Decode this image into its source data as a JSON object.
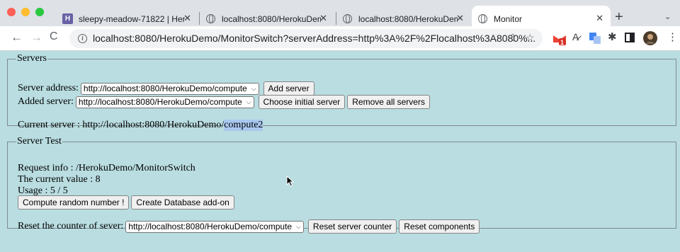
{
  "browser": {
    "tabs": [
      {
        "title": "sleepy-meadow-71822 | Her",
        "active": false,
        "favicon": "heroku-icon"
      },
      {
        "title": "localhost:8080/HerokuDemo",
        "active": false,
        "favicon": "globe-icon"
      },
      {
        "title": "localhost:8080/HerokuDemo",
        "active": false,
        "favicon": "globe-icon"
      },
      {
        "title": "Monitor",
        "active": true,
        "favicon": "globe-icon"
      }
    ],
    "close_glyph": "✕",
    "new_tab": "+",
    "tab_menu": "⌄",
    "url": "localhost:8080/HerokuDemo/MonitorSwitch?serverAddress=http%3A%2F%2Flocalhost%3A8080%...",
    "gmail_badge": "1"
  },
  "servers": {
    "legend": "Servers",
    "address_label": "Server address:",
    "address_value": "http://localhost:8080/HerokuDemo/compute",
    "add_button": "Add server",
    "added_label": "Added server:",
    "added_value": "http://localhost:8080/HerokuDemo/compute",
    "choose_button": "Choose initial server",
    "remove_button": "Remove all servers",
    "current_prefix": "Current server : http://localhost:8080/HerokuDemo/",
    "current_selected": "compute2"
  },
  "server_test": {
    "legend": "Server Test",
    "request_info": "Request info : /HerokuDemo/MonitorSwitch",
    "current_value": "The current value : 8",
    "usage": "Usage : 5 / 5",
    "compute_button": "Compute random number !",
    "database_button": "Create Database add-on",
    "reset_label": "Reset the counter of sever:",
    "reset_value": "http://localhost:8080/HerokuDemo/compute",
    "reset_server_button": "Reset server counter",
    "reset_components_button": "Reset components"
  },
  "colors": {
    "page_bg": "#b9dde1",
    "selection": "#a9c8f0",
    "tabbar": "#dee1e6"
  }
}
